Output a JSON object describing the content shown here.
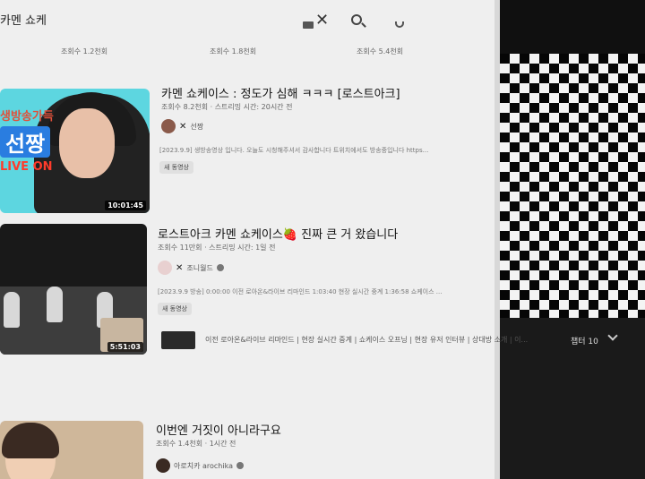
{
  "search": {
    "query": "카멘 쇼케"
  },
  "views_row": [
    "조회수 1.2천회",
    "조회수 1.8천회",
    "조회수 5.4천회"
  ],
  "videos": [
    {
      "title": "카멘 쇼케이스 : 정도가 심해 ㅋㅋㅋ [로스트아크]",
      "meta": "조회수 8.2천회 · 스트리밍 시간: 20시간 전",
      "channel": "선짱",
      "description": "[2023.9.9] 생방송영상 입니다. 오늘도 시청해주셔서 감사합니다 트위치에서도 방송중입니다 https...",
      "badge": "새 동영상",
      "duration": "10:01:45",
      "thumb_top_text": "생방송가득",
      "thumb_name": "선짱",
      "thumb_live": "LIVE ON"
    },
    {
      "title": "로스트아크 카멘 쇼케이스🍓 진짜 큰 거 왔습니다",
      "meta": "조회수 11만회 · 스트리밍 시간: 1일 전",
      "channel": "조니월드",
      "description": "[2023.9.9 방송] 0:00:00 이전 로아온&라이브 리마인드 1:03:40 현장 실시간 중계 1:36:58 쇼케이스 ...",
      "badge": "새 동영상",
      "duration": "5:51:03",
      "chapters_text": "이전 로아온&라이브 리마인드 | 현장 실시간 중계 | 쇼케이스 오프닝 | 현장 유저 인터뷰 | 상대방 소개 | 이...",
      "chapters_count": "챕터 10"
    },
    {
      "title": "이번엔 거짓이 아니라구요",
      "meta": "조회수 1.4천회 · 1시간 전",
      "channel": "아로치카 arochika"
    }
  ]
}
